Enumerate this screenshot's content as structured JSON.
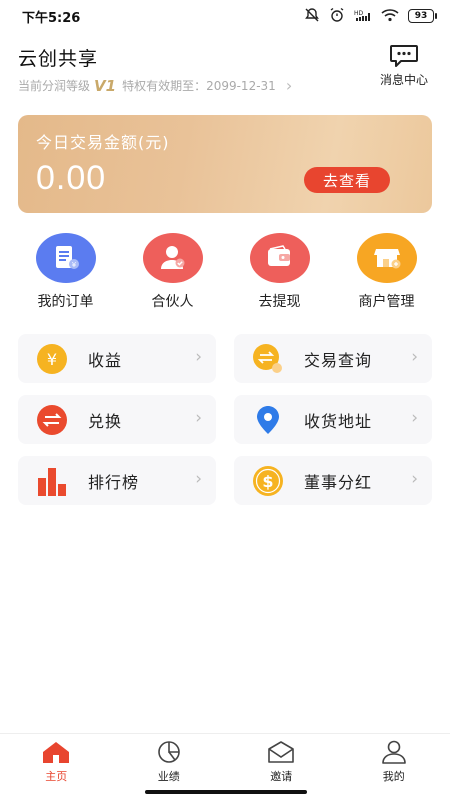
{
  "status_bar": {
    "time": "下午5:26",
    "battery": "93",
    "signal_text": "HD"
  },
  "header": {
    "app_title": "云创共享",
    "level_prefix": "当前分润等级",
    "level_value": "V1",
    "privilege_text": "特权有效期至：2099-12-31",
    "message_center_label": "消息中心"
  },
  "gold_card": {
    "label": "今日交易金额(元)",
    "amount": "0.00",
    "button_label": "去查看"
  },
  "quick_actions": [
    {
      "label": "我的订单",
      "icon": "receipt-icon",
      "color": "#5b7cf0"
    },
    {
      "label": "合伙人",
      "icon": "partner-icon",
      "color": "#ee5f5b"
    },
    {
      "label": "去提现",
      "icon": "wallet-icon",
      "color": "#ee5f5b"
    },
    {
      "label": "商户管理",
      "icon": "shop-icon",
      "color": "#f7a623"
    }
  ],
  "menu": [
    {
      "label": "收益",
      "icon": "yen-icon",
      "color": "#f6b321"
    },
    {
      "label": "交易查询",
      "icon": "exchange-search-icon",
      "color": "#f6b321"
    },
    {
      "label": "兑换",
      "icon": "swap-icon",
      "color": "#ea4a2e"
    },
    {
      "label": "收货地址",
      "icon": "location-pin-icon",
      "color": "#2f7be8"
    },
    {
      "label": "排行榜",
      "icon": "ranking-bar-icon",
      "color": "#ea4a2e"
    },
    {
      "label": "董事分红",
      "icon": "dollar-coin-icon",
      "color": "#f6b321"
    }
  ],
  "bottom_nav": [
    {
      "label": "主页",
      "icon": "home-icon",
      "active": true
    },
    {
      "label": "业绩",
      "icon": "pie-chart-icon",
      "active": false
    },
    {
      "label": "邀请",
      "icon": "envelope-icon",
      "active": false
    },
    {
      "label": "我的",
      "icon": "profile-icon",
      "active": false
    }
  ],
  "colors": {
    "accent_red": "#e8452f",
    "gold_start": "#e4b98a",
    "gold_end": "#f0d3ae"
  }
}
